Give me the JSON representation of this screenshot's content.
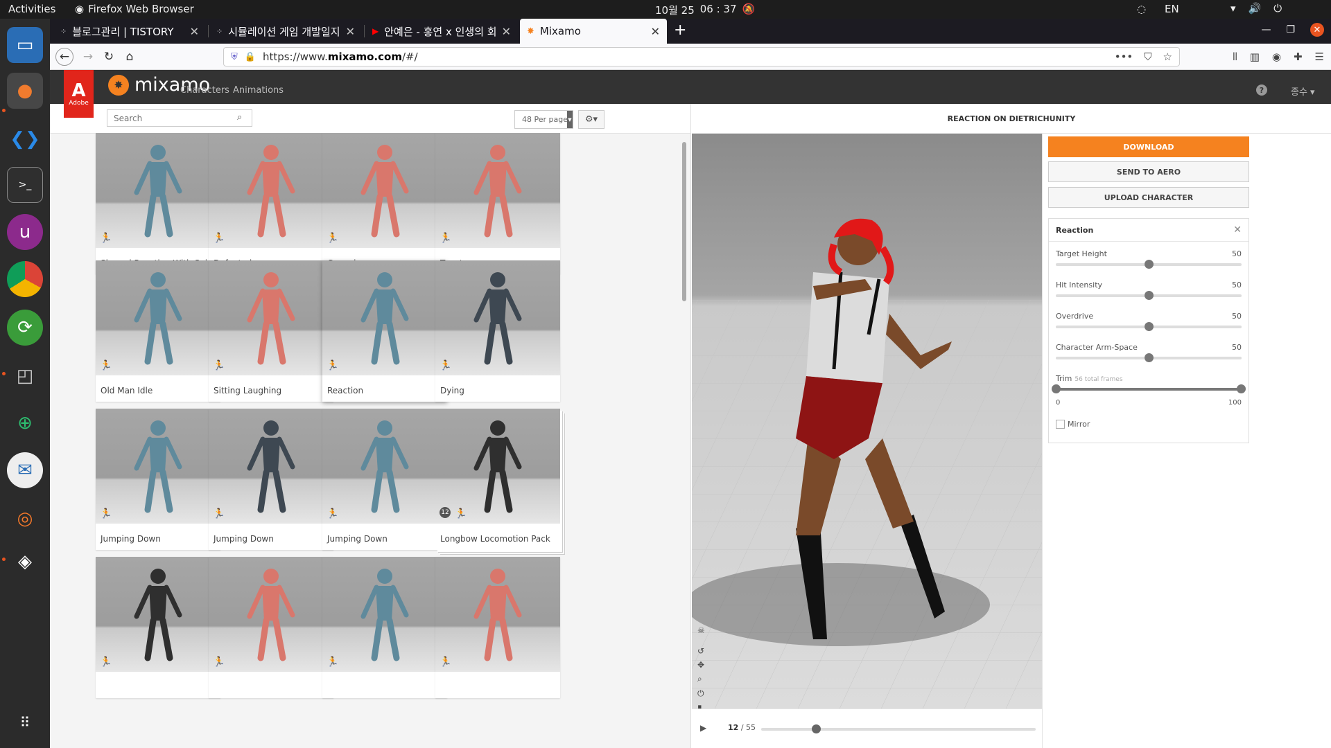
{
  "os": {
    "activities": "Activities",
    "app_name": "Firefox Web Browser",
    "clock_date": "10월 25",
    "clock_time": "06 : 37",
    "lang": "EN"
  },
  "browser": {
    "tabs": [
      {
        "title": "블로그관리 | TISTORY",
        "active": false
      },
      {
        "title": "시뮬레이션 게임 개발일지 ...",
        "active": false
      },
      {
        "title": "안예은 - 홍연 x 인생의 회전...",
        "active": false
      },
      {
        "title": "Mixamo",
        "active": true
      }
    ],
    "url_prefix": "https://www.",
    "url_host": "mixamo.com",
    "url_path": "/#/"
  },
  "mixamo": {
    "adobe_label": "Adobe",
    "brand": "mixamo",
    "nav": {
      "characters": "Characters",
      "animations": "Animations"
    },
    "user": "종수",
    "search_placeholder": "Search",
    "per_page": "48 Per page",
    "viewer_title": "REACTION ON DIETRICHUNITY",
    "frame_current": "12",
    "frame_total": "/ 55",
    "frame_progress": 0.2,
    "buttons": {
      "download": "DOWNLOAD",
      "send_aero": "SEND TO AERO",
      "upload": "UPLOAD CHARACTER"
    },
    "panel": {
      "title": "Reaction",
      "params": [
        {
          "label": "Target Height",
          "value": "50",
          "fraction": 0.5
        },
        {
          "label": "Hit Intensity",
          "value": "50",
          "fraction": 0.5
        },
        {
          "label": "Overdrive",
          "value": "50",
          "fraction": 0.5
        },
        {
          "label": "Character Arm-Space",
          "value": "50",
          "fraction": 0.5
        }
      ],
      "trim_label": "Trim",
      "trim_sub": "56 total frames",
      "trim_min": "0",
      "trim_max": "100",
      "mirror": "Mirror"
    },
    "cards": [
      {
        "label": "Shoved Reaction With Spin",
        "color": "#5f8a9c"
      },
      {
        "label": "Defeated",
        "color": "#d9776c"
      },
      {
        "label": "Capoeira",
        "color": "#d9776c"
      },
      {
        "label": "Taunt",
        "color": "#d9776c"
      },
      {
        "label": "Old Man Idle",
        "color": "#5f8a9c"
      },
      {
        "label": "Sitting Laughing",
        "color": "#d9776c"
      },
      {
        "label": "Reaction",
        "color": "#5f8a9c",
        "selected": true
      },
      {
        "label": "Dying",
        "color": "#3e4852"
      },
      {
        "label": "Jumping Down",
        "color": "#5f8a9c"
      },
      {
        "label": "Jumping Down",
        "color": "#3e4852"
      },
      {
        "label": "Jumping Down",
        "color": "#5f8a9c"
      },
      {
        "label": "Longbow Locomotion Pack",
        "color": "#2f2f2f",
        "pack_count": "12"
      },
      {
        "label": "",
        "color": "#2f2f2f"
      },
      {
        "label": "",
        "color": "#d9776c"
      },
      {
        "label": "",
        "color": "#5f8a9c"
      },
      {
        "label": "",
        "color": "#d9776c"
      }
    ]
  }
}
